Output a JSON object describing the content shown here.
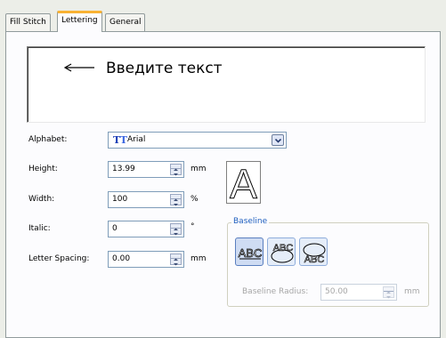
{
  "tabs": [
    {
      "label": "Fill Stitch"
    },
    {
      "label": "Lettering",
      "active": true
    },
    {
      "label": "General"
    }
  ],
  "text_input": {
    "value": "Введите текст"
  },
  "fields": {
    "alphabet": {
      "label": "Alphabet:",
      "value": "Arial"
    },
    "height": {
      "label": "Height:",
      "value": "13.99",
      "unit": "mm"
    },
    "width": {
      "label": "Width:",
      "value": "100",
      "unit": "%"
    },
    "italic": {
      "label": "Italic:",
      "value": "0",
      "unit": "°"
    },
    "letter_spacing": {
      "label": "Letter Spacing:",
      "value": "0.00",
      "unit": "mm"
    }
  },
  "preview": {
    "glyph": "A"
  },
  "baseline": {
    "title": "Baseline",
    "buttons": [
      {
        "icon": "baseline-straight-icon",
        "text": "ABC",
        "selected": true
      },
      {
        "icon": "baseline-arc-icon",
        "text": "ABC"
      },
      {
        "icon": "baseline-circle-icon",
        "text": "ABC"
      }
    ],
    "radius": {
      "label": "Baseline Radius:",
      "value": "50.00",
      "unit": "mm",
      "enabled": false
    }
  },
  "colors": {
    "background": "#eceee8",
    "panel": "#fcfcfe",
    "active_tab_accent": "#f9b233",
    "group_title": "#1f5fbf"
  }
}
